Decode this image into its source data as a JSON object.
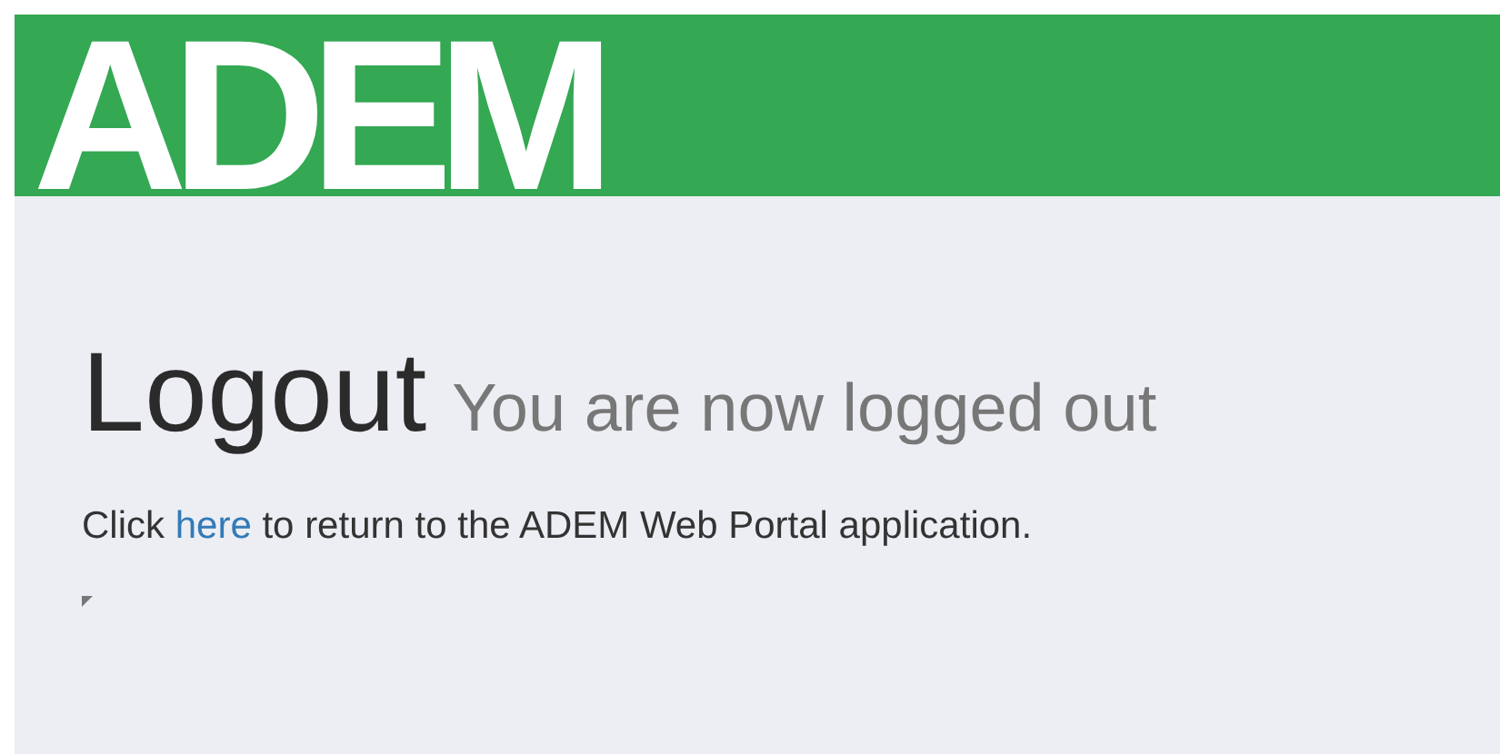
{
  "header": {
    "logo": "ADEM"
  },
  "heading": {
    "title": "Logout",
    "subtitle": "You are now logged out"
  },
  "message": {
    "before": "Click",
    "link": "here",
    "after": "to return to the ADEM Web Portal application."
  }
}
